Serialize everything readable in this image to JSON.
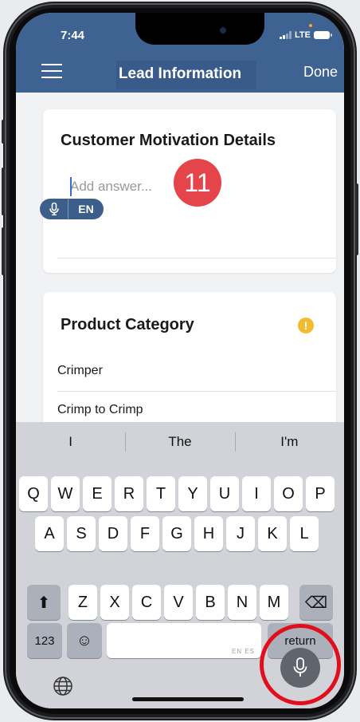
{
  "status_bar": {
    "time": "7:44",
    "network": "LTE"
  },
  "header": {
    "title": "Lead Information",
    "done_label": "Done",
    "menu_icon": "hamburger-icon",
    "background": "#3e6291"
  },
  "motivation_card": {
    "title": "Customer Motivation Details",
    "answer_placeholder": "Add answer...",
    "dictation_language": "EN",
    "dictation_icon": "microphone-icon"
  },
  "step_badge": {
    "label": "11",
    "color": "#e5444b"
  },
  "product_card": {
    "title": "Product Category",
    "warning_icon": "exclamation-icon",
    "warning_symbol": "!",
    "options": [
      "Crimper",
      "Crimp to Crimp"
    ]
  },
  "keyboard": {
    "suggestions": [
      "I",
      "The",
      "I'm"
    ],
    "rows": [
      [
        "Q",
        "W",
        "E",
        "R",
        "T",
        "Y",
        "U",
        "I",
        "O",
        "P"
      ],
      [
        "A",
        "S",
        "D",
        "F",
        "G",
        "H",
        "J",
        "K",
        "L"
      ],
      [
        "Z",
        "X",
        "C",
        "V",
        "B",
        "N",
        "M"
      ]
    ],
    "numbers_label": "123",
    "emoji_symbol": "☺",
    "return_label": "return",
    "space_languages": "EN ES",
    "shift_symbol": "⬆",
    "delete_symbol": "⌫"
  },
  "highlight_color": "#e10f1e"
}
